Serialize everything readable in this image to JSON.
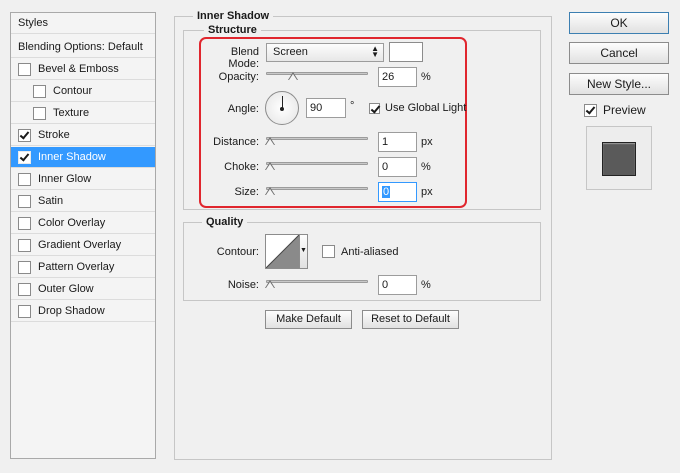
{
  "left_panel": {
    "header": "Styles",
    "blending_options": "Blending Options: Default",
    "items": [
      {
        "label": "Bevel & Emboss",
        "checked": false,
        "selected": false,
        "indent": false
      },
      {
        "label": "Contour",
        "checked": false,
        "selected": false,
        "indent": true
      },
      {
        "label": "Texture",
        "checked": false,
        "selected": false,
        "indent": true
      },
      {
        "label": "Stroke",
        "checked": true,
        "selected": false,
        "indent": false
      },
      {
        "label": "Inner Shadow",
        "checked": true,
        "selected": true,
        "indent": false
      },
      {
        "label": "Inner Glow",
        "checked": false,
        "selected": false,
        "indent": false
      },
      {
        "label": "Satin",
        "checked": false,
        "selected": false,
        "indent": false
      },
      {
        "label": "Color Overlay",
        "checked": false,
        "selected": false,
        "indent": false
      },
      {
        "label": "Gradient Overlay",
        "checked": false,
        "selected": false,
        "indent": false
      },
      {
        "label": "Pattern Overlay",
        "checked": false,
        "selected": false,
        "indent": false
      },
      {
        "label": "Outer Glow",
        "checked": false,
        "selected": false,
        "indent": false
      },
      {
        "label": "Drop Shadow",
        "checked": false,
        "selected": false,
        "indent": false
      }
    ]
  },
  "inner_shadow": {
    "title": "Inner Shadow",
    "structure_title": "Structure",
    "blend_mode_label": "Blend Mode:",
    "blend_mode_value": "Screen",
    "shadow_color": "#ffffff",
    "opacity_label": "Opacity:",
    "opacity_value": "26",
    "opacity_unit": "%",
    "opacity_fraction": 0.26,
    "angle_label": "Angle:",
    "angle_value": "90",
    "angle_unit": "°",
    "use_global_light_label": "Use Global Light",
    "use_global_light_checked": true,
    "distance_label": "Distance:",
    "distance_value": "1",
    "distance_unit": "px",
    "choke_label": "Choke:",
    "choke_value": "0",
    "choke_unit": "%",
    "size_label": "Size:",
    "size_value": "0",
    "size_unit": "px"
  },
  "quality": {
    "title": "Quality",
    "contour_label": "Contour:",
    "anti_aliased_label": "Anti-aliased",
    "anti_aliased_checked": false,
    "noise_label": "Noise:",
    "noise_value": "0",
    "noise_unit": "%"
  },
  "actions": {
    "make_default": "Make Default",
    "reset_to_default": "Reset to Default"
  },
  "right_panel": {
    "ok": "OK",
    "cancel": "Cancel",
    "new_style": "New Style...",
    "preview_label": "Preview",
    "preview_checked": true,
    "preview_swatch_color": "#5a5a5a"
  },
  "colors": {
    "selection": "#3399ff",
    "highlight_border": "#e0262e"
  }
}
